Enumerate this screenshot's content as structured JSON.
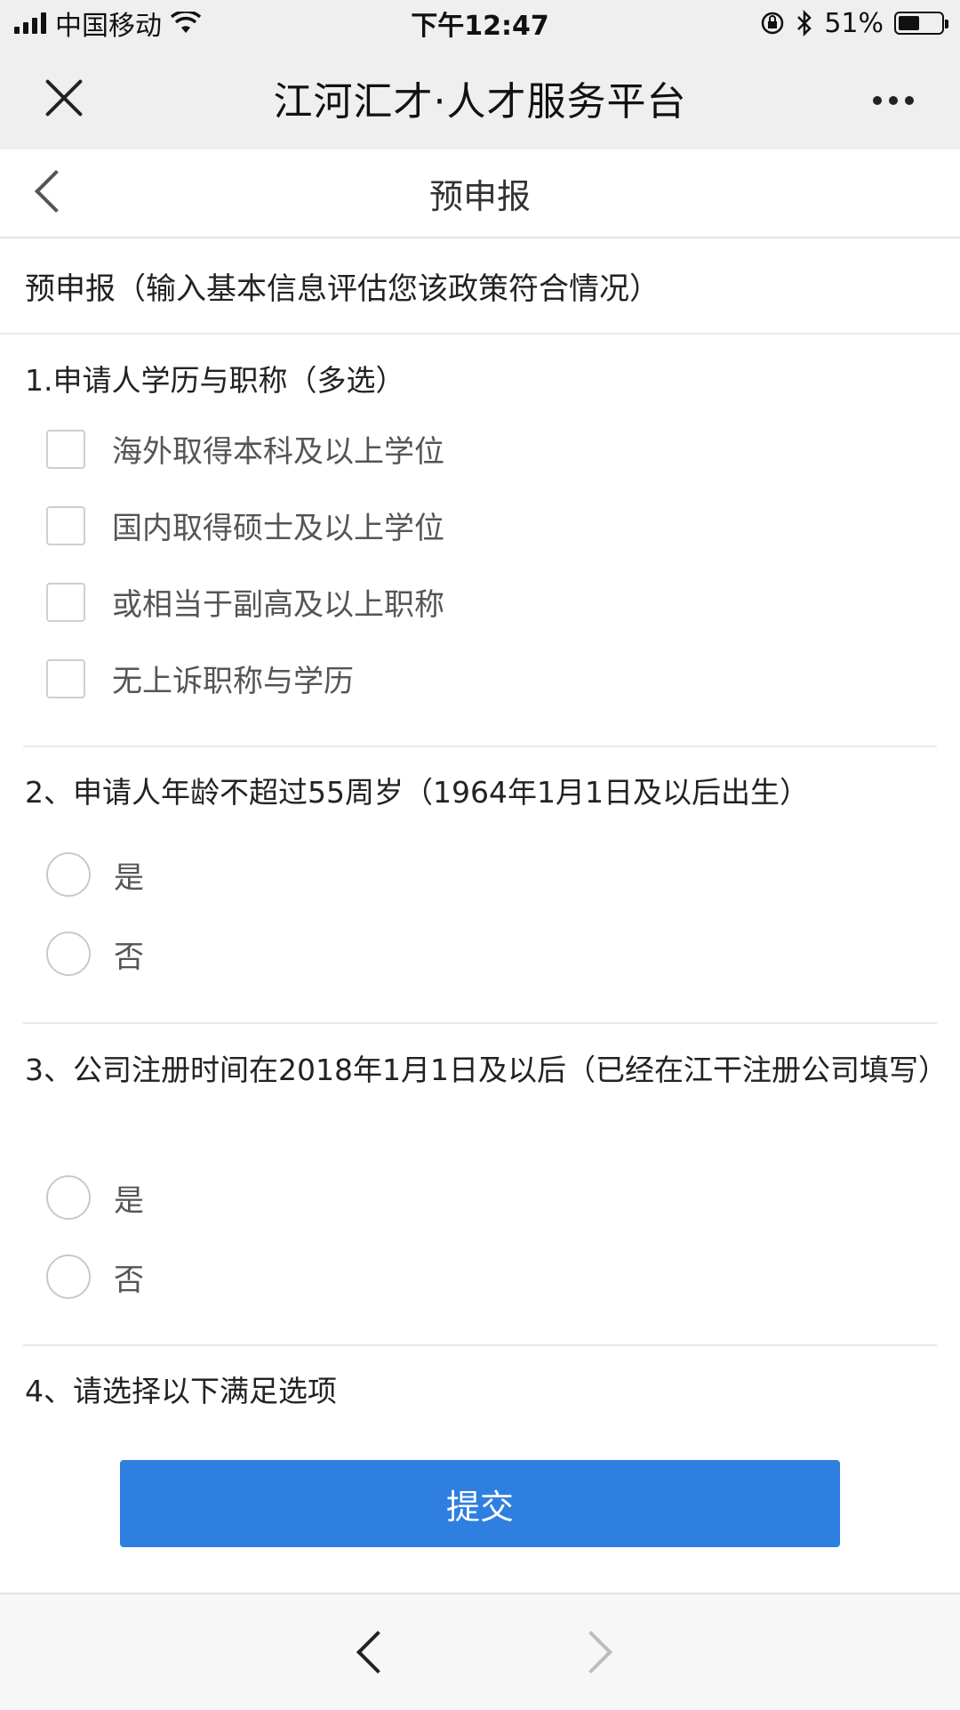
{
  "status_bar": {
    "carrier": "中国移动",
    "time": "下午12:47",
    "battery_text": "51%",
    "battery_level": 0.51,
    "icons": [
      "signal-icon",
      "wifi-icon",
      "rotation-lock-icon",
      "bluetooth-icon",
      "battery-icon"
    ]
  },
  "wechat_bar": {
    "title": "江河汇才·人才服务平台"
  },
  "page": {
    "title": "预申报",
    "intro": "预申报（输入基本信息评估您该政策符合情况）"
  },
  "questions": [
    {
      "title": "1.申请人学历与职称（多选）",
      "type": "checkbox",
      "options": [
        "海外取得本科及以上学位",
        "国内取得硕士及以上学位",
        "或相当于副高及以上职称",
        "无上诉职称与学历"
      ]
    },
    {
      "title": "2、申请人年龄不超过55周岁（1964年1月1日及以后出生）",
      "type": "radio",
      "options": [
        "是",
        "否"
      ]
    },
    {
      "title": "3、公司注册时间在2018年1月1日及以后（已经在江干注册公司填写）",
      "type": "radio",
      "options": [
        "是",
        "否"
      ]
    },
    {
      "title": "4、请选择以下满足选项",
      "type": "checkbox",
      "options": []
    }
  ],
  "submit_label": "提交",
  "colors": {
    "accent": "#2f7fe0",
    "toolbar_bg": "#efefef",
    "page_bg": "#ffffff"
  }
}
